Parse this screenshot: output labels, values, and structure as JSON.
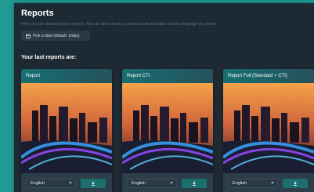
{
  "header": {
    "title": "Reports",
    "subtitle": "Here you can download your reports. You can also choose a previous checked date and the language you prefer.",
    "date_button_label": "Pick a date (default: today)"
  },
  "section_title": "Your last reports are:",
  "cards": [
    {
      "title": "Report",
      "language": "English"
    },
    {
      "title": "Report CTI",
      "language": "English"
    },
    {
      "title": "Report Full (Standard + CTI)",
      "language": "English"
    }
  ],
  "icons": {
    "date_button": "calendar-icon",
    "download": "download-icon",
    "select": "chevron-down-icon"
  },
  "colors": {
    "background": "#1f9a95",
    "panel": "#1e2a33",
    "accent": "#1d6e6f"
  }
}
